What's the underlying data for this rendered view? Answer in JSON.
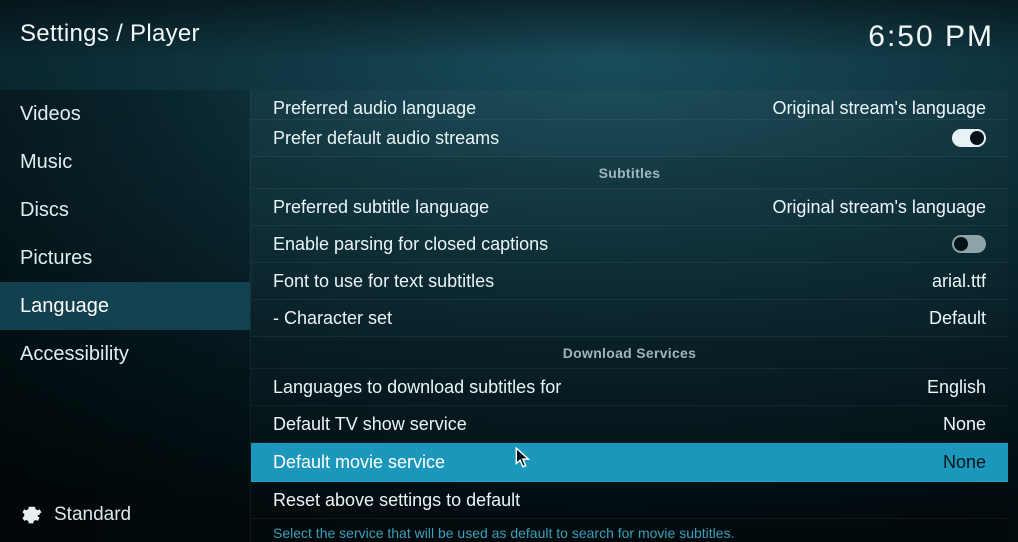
{
  "header": {
    "breadcrumb": "Settings / Player",
    "clock": "6:50 PM"
  },
  "sidebar": {
    "items": [
      {
        "label": "Videos",
        "active": false
      },
      {
        "label": "Music",
        "active": false
      },
      {
        "label": "Discs",
        "active": false
      },
      {
        "label": "Pictures",
        "active": false
      },
      {
        "label": "Language",
        "active": true
      },
      {
        "label": "Accessibility",
        "active": false
      }
    ],
    "level_label": "Standard"
  },
  "main": {
    "rows": [
      {
        "kind": "setting_cut",
        "label": "Preferred audio language",
        "value": "Original stream's language"
      },
      {
        "kind": "toggle",
        "label": "Prefer default audio streams",
        "on": true
      },
      {
        "kind": "section",
        "title": "Subtitles"
      },
      {
        "kind": "setting",
        "label": "Preferred subtitle language",
        "value": "Original stream's language"
      },
      {
        "kind": "toggle",
        "label": "Enable parsing for closed captions",
        "on": false
      },
      {
        "kind": "setting",
        "label": "Font to use for text subtitles",
        "value": "arial.ttf"
      },
      {
        "kind": "setting",
        "label": "- Character set",
        "value": "Default"
      },
      {
        "kind": "section",
        "title": "Download Services"
      },
      {
        "kind": "setting",
        "label": "Languages to download subtitles for",
        "value": "English"
      },
      {
        "kind": "setting",
        "label": "Default TV show service",
        "value": "None"
      },
      {
        "kind": "setting",
        "label": "Default movie service",
        "value": "None",
        "selected": true
      },
      {
        "kind": "action",
        "label": "Reset above settings to default"
      }
    ],
    "hint": "Select the service that will be used as default to search for movie subtitles."
  }
}
